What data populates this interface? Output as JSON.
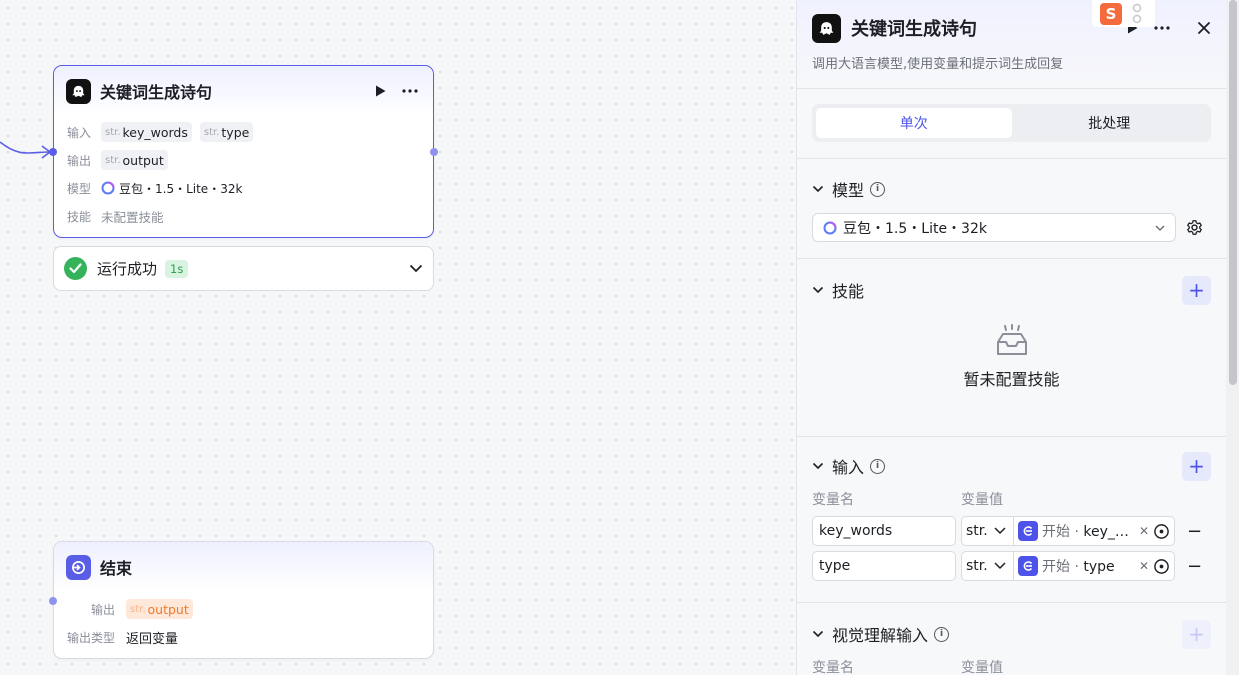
{
  "llm_node": {
    "title": "关键词生成诗句",
    "input_label": "输入",
    "inputs": [
      {
        "type": "str.",
        "name": "key_words"
      },
      {
        "type": "str.",
        "name": "type"
      }
    ],
    "output_label": "输出",
    "output": {
      "type": "str.",
      "name": "output"
    },
    "model_label": "模型",
    "model": "豆包・1.5・Lite・32k",
    "skill_label": "技能",
    "skill_value": "未配置技能"
  },
  "run_status": {
    "text": "运行成功",
    "time": "1s"
  },
  "end_node": {
    "title": "结束",
    "output_label": "输出",
    "output": {
      "type": "str.",
      "name": "output"
    },
    "output_type_label": "输出类型",
    "output_type_value": "返回变量"
  },
  "panel": {
    "title": "关键词生成诗句",
    "description": "调用大语言模型,使用变量和提示词生成回复",
    "tabs": [
      "单次",
      "批处理"
    ],
    "model_section": {
      "title": "模型",
      "value": "豆包・1.5・Lite・32k"
    },
    "skill_section": {
      "title": "技能",
      "empty_text": "暂未配置技能"
    },
    "input_section": {
      "title": "输入",
      "col_name": "变量名",
      "col_value": "变量值",
      "rows": [
        {
          "name": "key_words",
          "type": "str.",
          "ref_source": "开始",
          "ref_var": "key_…"
        },
        {
          "name": "type",
          "type": "str.",
          "ref_source": "开始",
          "ref_var": "type"
        }
      ]
    },
    "vision_section": {
      "title": "视觉理解输入",
      "col_name": "变量名",
      "col_value": "变量值"
    }
  },
  "corner_logo": "S"
}
